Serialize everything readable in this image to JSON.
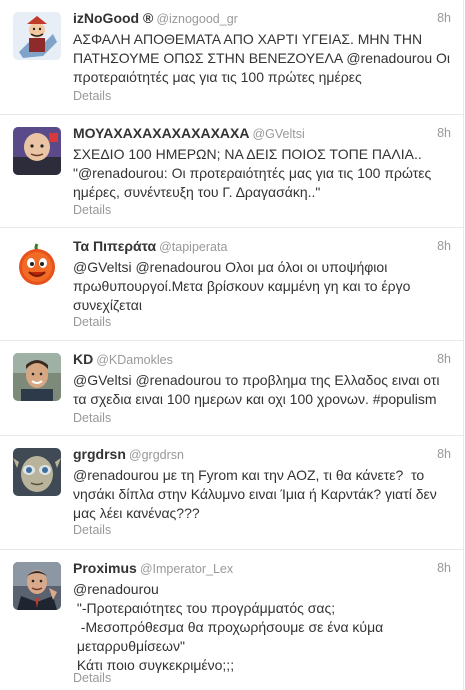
{
  "tweets": [
    {
      "name": "izNoGood ®",
      "handle": "@iznogood_gr",
      "time": "8h",
      "lines": [
        "ΑΣΦΑΛΗ ΑΠΟΘΕΜΑΤΑ ΑΠΟ ΧΑΡΤΙ ΥΓΕΙΑΣ. ΜΗΝ ΤΗΝ",
        "ΠΑΤΗΣΟΥΜΕ ΟΠΩΣ ΣΤΗΝ ΒΕΝΕΖΟΥΕΛΑ @renadourou Οι",
        "προτεραιότητές μας για τις 100 πρώτες ημέρες"
      ],
      "details": "Details",
      "avatar_icon": "cartoon-villain-avatar-icon"
    },
    {
      "name": "ΜΟΥΑΧΑΧΑΧΑΧΑΧΑΧΑΧΑ",
      "handle": "@GVeltsi",
      "time": "8h",
      "lines": [
        "ΣΧΕΔΙΟ 100 ΗΜΕΡΩΝ; ΝΑ ΔΕΙΣ ΠΟΙΟΣ ΤΟΠΕ ΠΑΛΙΑ..",
        "\"@renadourou: Οι προτεραιότητές μας για τις 100 πρώτες",
        "ημέρες, συνέντευξη του Γ. Δραγασάκη..\""
      ],
      "details": "Details",
      "avatar_icon": "bald-villain-avatar-icon"
    },
    {
      "name": "Τα Πιπεράτα",
      "handle": "@tapiperata",
      "time": "8h",
      "lines": [
        "@GVeltsi @renadourou Ολοι μα όλοι οι υποψήφιοι",
        "πρωθυπουργοί.Μετα βρίσκουν καμμένη γη και το έργο",
        "συνεχίζεται"
      ],
      "details": "Details",
      "avatar_icon": "pepper-mascot-avatar-icon"
    },
    {
      "name": "KD",
      "handle": "@KDamokles",
      "time": "8h",
      "lines": [
        "@GVeltsi @renadourou το προβλημα της Ελλαδος ειναι οτι",
        "τα σχεδια ειναι 100 ημερων και οχι 100 χρονων. #populism"
      ],
      "details": "Details",
      "avatar_icon": "man-portrait-avatar-icon"
    },
    {
      "name": "grgdrsn",
      "handle": "@grgdrsn",
      "time": "8h",
      "lines": [
        "@renadourou με τη Fyrom και την ΑΟΖ, τι θα κάνετε?  το",
        "νησάκι δίπλα στην Κάλυμνο ειναι Ίμια ή Καρντάκ? γιατί δεν",
        "μας λέει κανένας???"
      ],
      "details": "Details",
      "avatar_icon": "gollum-avatar-icon"
    },
    {
      "name": "Proximus",
      "handle": "@Imperator_Lex",
      "time": "8h",
      "lines": [
        "@renadourou",
        " \"-Προτεραιότητες του προγράμματός σας;",
        "  -Μεσοπρόθεσμα θα προχωρήσουμε σε ένα κύμα",
        " μεταρρυθμίσεων\"",
        " Κάτι ποιο συγκεκριμένο;;;"
      ],
      "details": "Details",
      "avatar_icon": "suited-man-avatar-icon"
    }
  ]
}
